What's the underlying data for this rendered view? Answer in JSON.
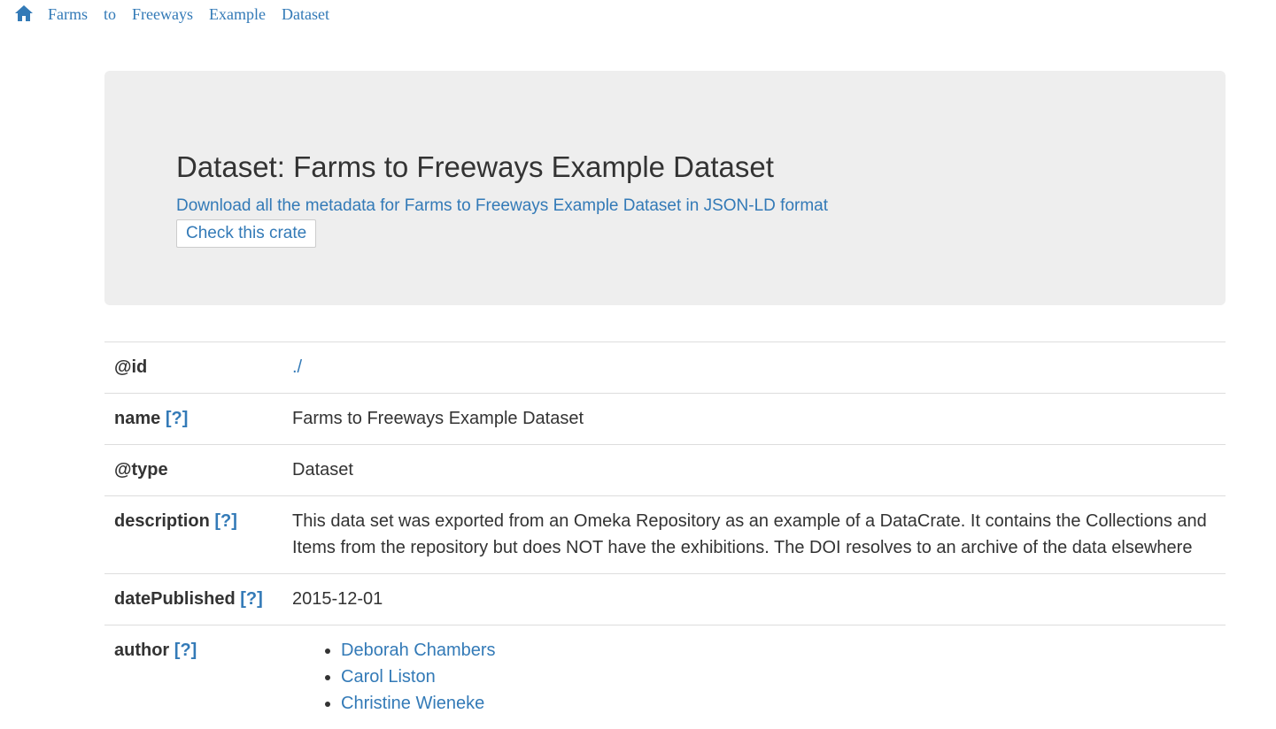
{
  "breadcrumb": {
    "home_icon": "home-icon",
    "words": [
      "Farms",
      "to",
      "Freeways",
      "Example",
      "Dataset"
    ]
  },
  "header": {
    "title": "Dataset: Farms to Freeways Example Dataset",
    "download_link": "Download all the metadata for Farms to Freeways Example Dataset in JSON-LD format",
    "check_button": "Check this crate"
  },
  "properties": {
    "id": {
      "key": "@id",
      "value": "./"
    },
    "name": {
      "key": "name",
      "help": "[?]",
      "value": "Farms to Freeways Example Dataset"
    },
    "type": {
      "key": "@type",
      "value": "Dataset"
    },
    "description": {
      "key": "description",
      "help": "[?]",
      "value": "This data set was exported from an Omeka Repository as an example of a DataCrate. It contains the Collections and Items from the repository but does NOT have the exhibitions. The DOI resolves to an archive of the data elsewhere"
    },
    "datePublished": {
      "key": "datePublished",
      "help": "[?]",
      "value": "2015-12-01"
    },
    "author": {
      "key": "author",
      "help": "[?]",
      "values": [
        "Deborah Chambers",
        "Carol Liston",
        "Christine Wieneke"
      ]
    }
  },
  "colors": {
    "link": "#337ab7",
    "text": "#333333",
    "jumbotron_bg": "#eeeeee",
    "border": "#dddddd"
  }
}
